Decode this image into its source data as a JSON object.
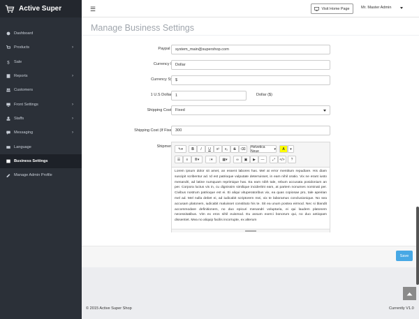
{
  "brand": {
    "title": "Active Super"
  },
  "sidebar": {
    "items": [
      {
        "label": "Dashboard",
        "icon": "dashboard-icon",
        "chevron": false,
        "active": false
      },
      {
        "label": "Products",
        "icon": "cart-icon",
        "chevron": true,
        "active": false
      },
      {
        "label": "Sale",
        "icon": "dollar-icon",
        "chevron": false,
        "active": false
      },
      {
        "label": "Reports",
        "icon": "report-icon",
        "chevron": true,
        "active": false
      },
      {
        "label": "Customers",
        "icon": "users-icon",
        "chevron": false,
        "active": false
      },
      {
        "label": "Front Settings",
        "icon": "monitor-icon",
        "chevron": true,
        "active": false
      },
      {
        "label": "Staffs",
        "icon": "staff-icon",
        "chevron": true,
        "active": false
      },
      {
        "label": "Messaging",
        "icon": "chat-icon",
        "chevron": true,
        "active": false
      },
      {
        "label": "Language",
        "icon": "language-icon",
        "chevron": false,
        "active": false
      },
      {
        "label": "Business Settings",
        "icon": "business-icon",
        "chevron": false,
        "active": true
      },
      {
        "label": "Manage Admin Profile",
        "icon": "profile-icon",
        "chevron": false,
        "active": false
      }
    ]
  },
  "header": {
    "menu_icon": "☰",
    "visit_label": "Visit Home Page",
    "admin_name": "Mr. Master Admin"
  },
  "page": {
    "title": "Manage Business Settings"
  },
  "form": {
    "paypal_label": "Paypal Email",
    "paypal_value": "system_main@supershop.com",
    "currency_name_label": "Currency Name",
    "currency_name_value": "Dollar",
    "currency_symbol_label": "Currency Symbol",
    "currency_symbol_value": "$",
    "rate_label": "1 U.S Dollar ($) =",
    "rate_value": "1",
    "rate_unit": "Dollar ($)",
    "shipping_type_label": "Shipping Cost Type",
    "shipping_type_value": "Fixed",
    "shipping_cost_label": "Shipping Cost (If Fixed) ($)",
    "shipping_cost_value": "300",
    "shipment_info_label": "Shipment Info",
    "font_select": "Helvetica Neue",
    "editor_text": "Lorem ipsum dolor sit amet, an essent labores has. Mel at error mentitum repudiare. His diam suscipit scribentur ad. Id est patrioque vulputate deterruisset, in eam nihil oratio. Vix ne erant iusto menandri, ad latine numquam reprimique has. Ea eam nibh tale, rebum accusata posidonium an per. Corpora luctus vis in, cu dignissim similique incideritnt eam, at partem nonumes nominati per. Civibus nostrum patrioque est ei. Ei aliqui vituperatoribus vix, ea quas copiosae pro, tale apeirian mel ad. Mel nulla debet ei, ad iudicabit scriptorem mei, vix te laboramus conclusionique. No sea accusam platonem, iudicabit maluisset constituto his te. Sit ea unum postea eirmod. Nec si blandit accommodare definitionem, no duo epicuri menandri voluptaria, ei qui laudem platonem necessitatibus. Vim ex eros nihil euismod. Eu assum exerci bonorum qui, no duo antiopam dissentiet. Mea no aliquip facilis incorrupte, ex alterum"
  },
  "actions": {
    "save_label": "Save"
  },
  "footer": {
    "copyright": "© 2015 Active Super Shop",
    "version": "Currently V1.0"
  },
  "colors": {
    "sidebar_bg": "#2b3038",
    "brand_bg": "#23272e",
    "save_button": "#47a8e5",
    "title_gray": "#a0a6ad"
  }
}
